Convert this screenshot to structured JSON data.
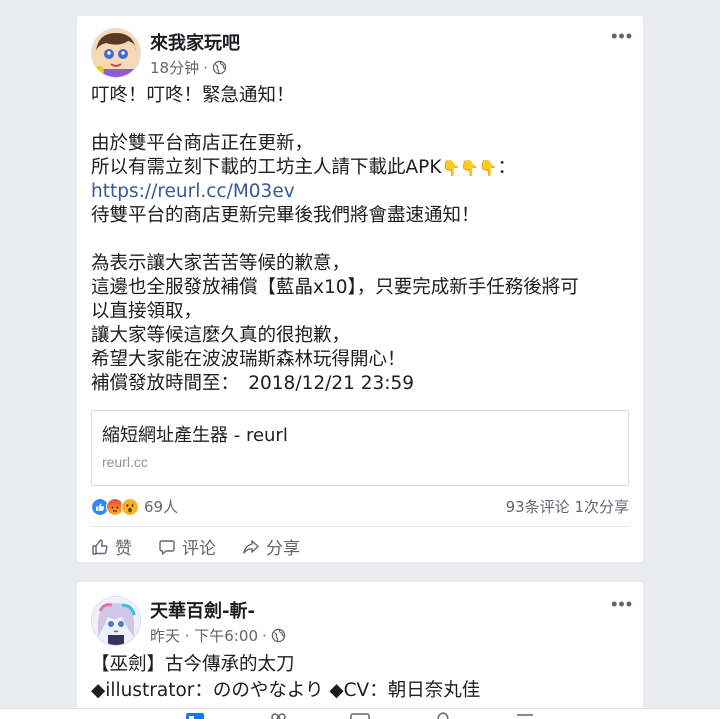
{
  "posts": [
    {
      "author": "來我家玩吧",
      "time": "18分钟",
      "separator": "·",
      "more_label": "•••",
      "text_lines": [
        "叮咚！叮咚！緊急通知！",
        "",
        "由於雙平台商店正在更新，",
        "所以有需立刻下載的工坊主人請下載此APK",
        "https://reurl.cc/M03ev",
        "待雙平台的商店更新完畢後我們將會盡速通知！",
        "",
        "為表示讓大家苦苦等候的歉意，",
        "這邊也全服發放補償【藍晶x10】，只要完成新手任務後將可",
        "以直接領取，",
        "讓大家等候這麼久真的很抱歉，",
        "希望大家能在波波瑞斯森林玩得開心！",
        "補償發放時間至：　2018/12/21 23:59"
      ],
      "pointing_emoji": "👇👇👇",
      "pointing_suffix": "：",
      "link_preview": {
        "title": "縮短網址產生器 - reurl",
        "domain": "reurl.cc"
      },
      "reactions": {
        "count": "69人",
        "types": [
          "like",
          "angry",
          "wow"
        ]
      },
      "comments": "93条评论",
      "shares": "1次分享",
      "actions": {
        "like": "赞",
        "comment": "评论",
        "share": "分享"
      }
    },
    {
      "author": "天華百劍-斬-",
      "time": "昨天 · 下午6:00",
      "separator": "·",
      "more_label": "•••",
      "text_lines": [
        "【巫劍】古今傳承的太刀",
        "◆illustrator：ののやなより ◆CV：朝日奈丸佳"
      ]
    }
  ],
  "colors": {
    "background": "#e9ebee",
    "link": "#385898",
    "like_blue": "#2d88ff",
    "angry_orange": "#f0703c",
    "wow_yellow": "#f7b125",
    "nav_active": "#1877f2"
  }
}
